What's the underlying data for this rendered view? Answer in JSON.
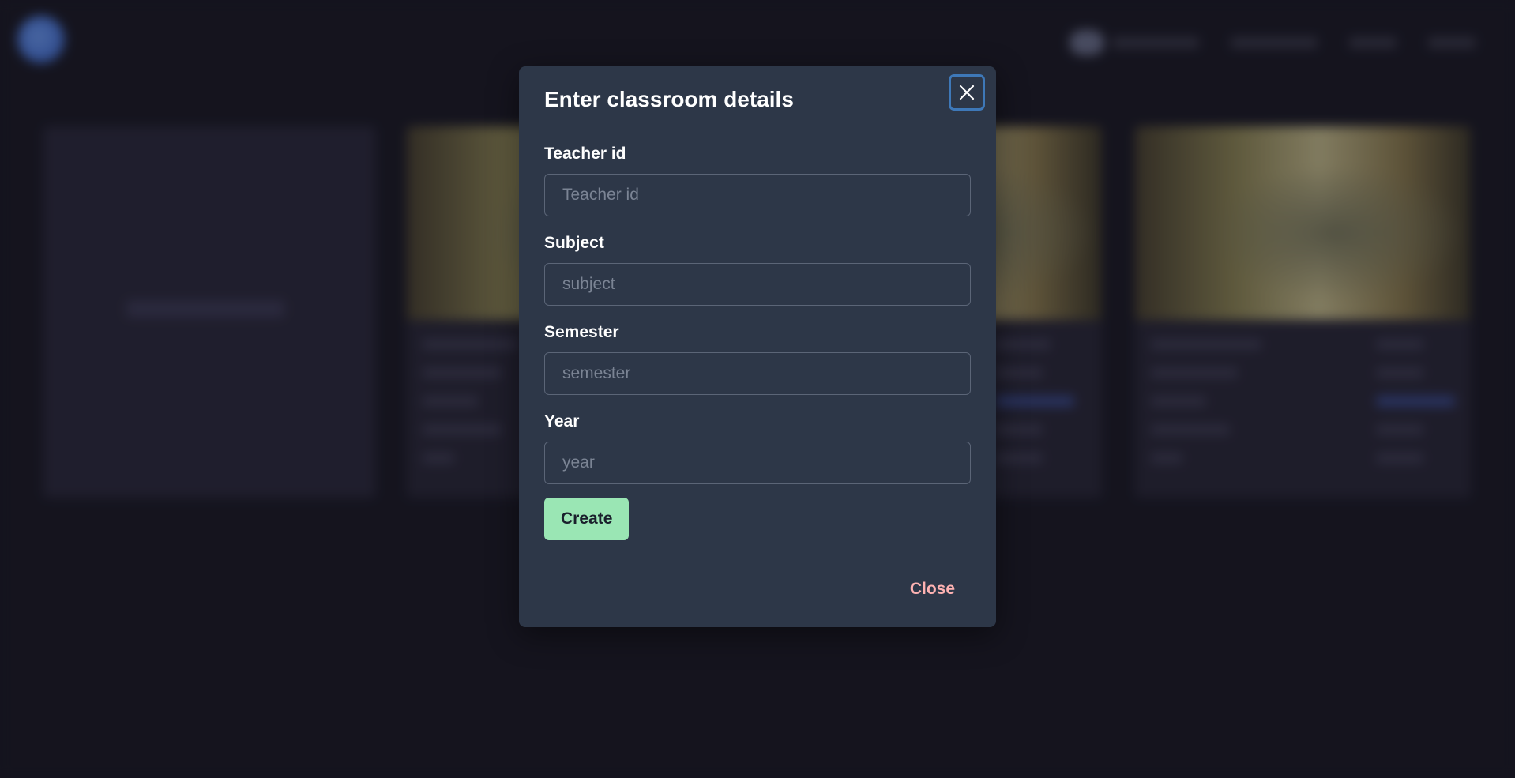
{
  "modal": {
    "title": "Enter classroom details",
    "close_icon": "close-icon",
    "fields": [
      {
        "label": "Teacher id",
        "placeholder": "Teacher id",
        "value": ""
      },
      {
        "label": "Subject",
        "placeholder": "subject",
        "value": ""
      },
      {
        "label": "Semester",
        "placeholder": "semester",
        "value": ""
      },
      {
        "label": "Year",
        "placeholder": "year",
        "value": ""
      }
    ],
    "create_label": "Create",
    "close_label": "Close"
  },
  "colors": {
    "modal_bg": "#2d3748",
    "create_button": "#9ae6b4",
    "close_link": "#feb2b2",
    "focus_ring": "#3e78b8",
    "page_bg": "#1c1b26"
  }
}
